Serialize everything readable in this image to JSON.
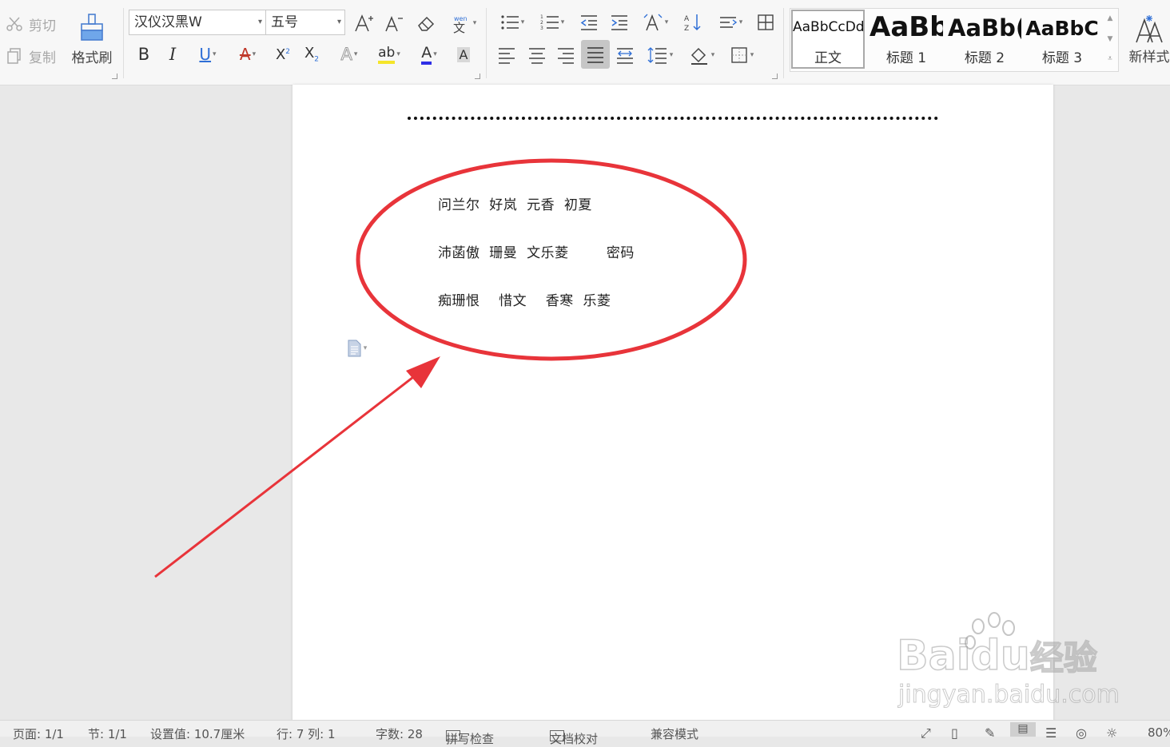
{
  "clipboard": {
    "cut": "剪切",
    "copy": "复制",
    "format_painter": "格式刷"
  },
  "font": {
    "name": "汉仪汉黑W",
    "size": "五号"
  },
  "styles": [
    {
      "preview": "AaBbCcDd",
      "name": "正文"
    },
    {
      "preview": "AaBb",
      "name": "标题 1"
    },
    {
      "preview": "AaBb(",
      "name": "标题 2"
    },
    {
      "preview": "AaBbC",
      "name": "标题 3"
    }
  ],
  "new_style": "新样式",
  "document": {
    "lines": [
      "问兰尔  好岚  元香  初夏",
      "沛菡傲  珊曼  文乐菱        密码",
      "痴珊恨    惜文    香寒  乐菱"
    ]
  },
  "annotation_color": "#e8343a",
  "status": {
    "page": "页面: 1/1",
    "section": "节: 1/1",
    "position": "设置值: 10.7厘米",
    "row_col": "行: 7   列: 1",
    "word_count": "字数: 28",
    "spell_check": "拼写检查",
    "doc_check": "文档校对",
    "compat": "兼容模式",
    "zoom": "80%"
  },
  "watermark": {
    "brand": "Bai",
    "brand2": "du",
    "cn": "经验",
    "url": "jingyan.baidu.com"
  }
}
